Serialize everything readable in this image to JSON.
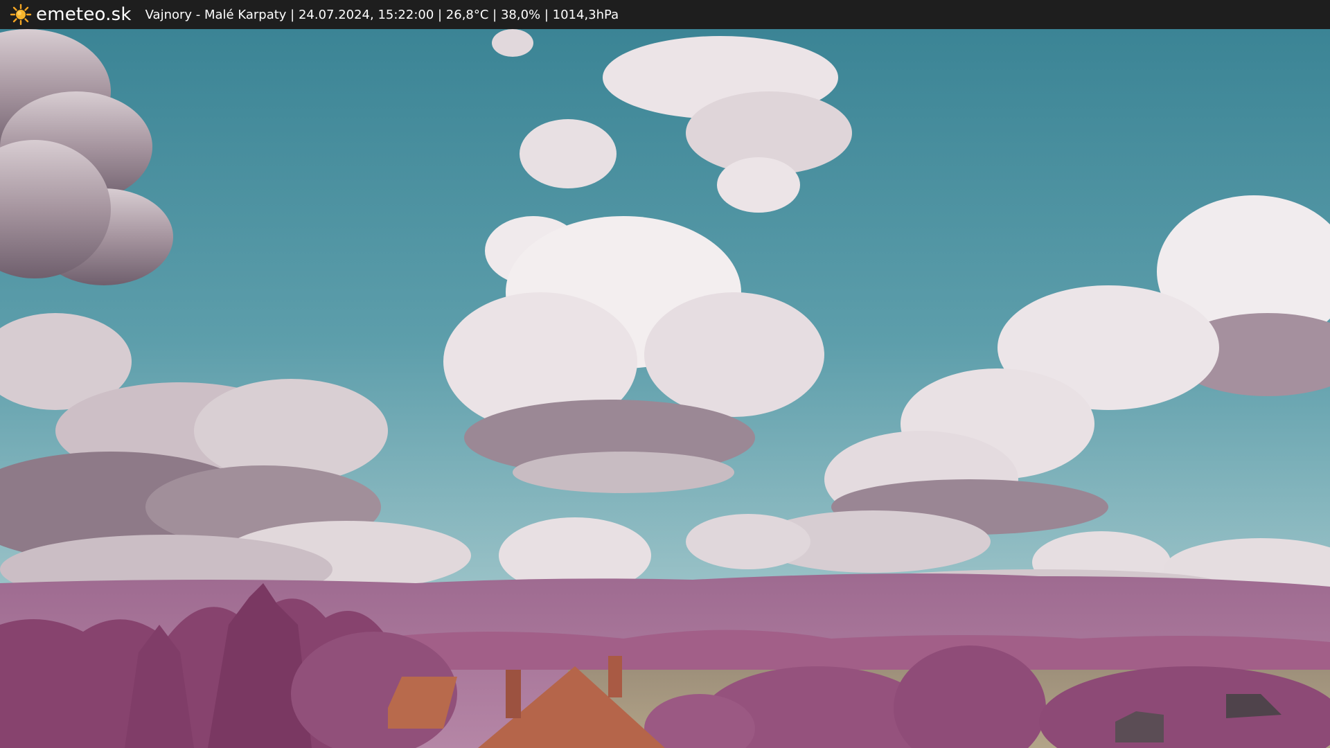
{
  "header": {
    "brand": "emeteo.sk",
    "caption": "Vajnory - Malé Karpaty | 24.07.2024, 15:22:00 | 26,8°C | 38,0% | 1014,3hPa",
    "logo_icon": "sun-icon",
    "bar_color": "#1e1e1e",
    "logo_color": "#f5a623"
  },
  "scene": {
    "colors": {
      "sky_top": "#3e8697",
      "sky_bottom": "#86b6bf",
      "cloud_light": "#f1ecee",
      "cloud_shadow": "#8a7886",
      "hills": "#a06c92",
      "foliage": "#8e4a74",
      "field": "#a89a80",
      "roof": "#b5654a"
    }
  }
}
